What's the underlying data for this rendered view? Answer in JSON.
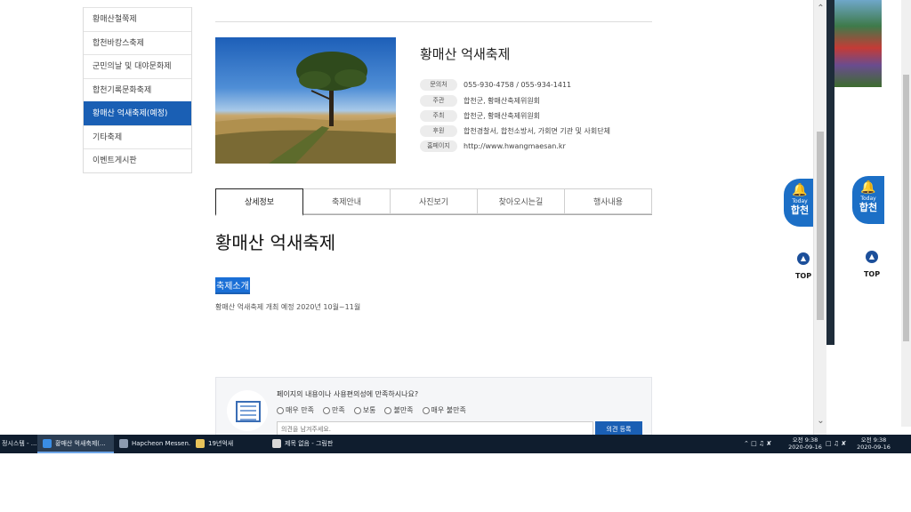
{
  "sidebar": {
    "items": [
      {
        "label": "황매산철쭉제"
      },
      {
        "label": "합천바캉스축제"
      },
      {
        "label": "군민의날 및 대야문화제"
      },
      {
        "label": "합천기록문화축제"
      },
      {
        "label": "황매산 억새축제(예정)"
      },
      {
        "label": "기타축제"
      },
      {
        "label": "이벤트게시판"
      }
    ]
  },
  "festival": {
    "title": "황매산 억새축제",
    "info": [
      {
        "label": "문의처",
        "value": "055-930-4758 / 055-934-1411"
      },
      {
        "label": "주관",
        "value": "합천군, 황매산축제위원회"
      },
      {
        "label": "주최",
        "value": "합천군, 황매산축제위원회"
      },
      {
        "label": "후원",
        "value": "합천경찰서, 합천소방서, 가회면 기관 및 사회단체"
      },
      {
        "label": "홈페이지",
        "value": "http://www.hwangmaesan.kr"
      }
    ]
  },
  "tabs": [
    {
      "label": "상세정보"
    },
    {
      "label": "축제안내"
    },
    {
      "label": "사진보기"
    },
    {
      "label": "찾아오시는길"
    },
    {
      "label": "행사내용"
    }
  ],
  "content": {
    "title": "황매산 억새축제",
    "intro_label": "축제소개",
    "intro_text": "황매산 억새축제 개최 예정 2020년 10월~11월"
  },
  "survey": {
    "question": "페이지의 내용이나 사용편의성에 만족하시나요?",
    "options": [
      "매우 만족",
      "만족",
      "보통",
      "불만족",
      "매우 불만족"
    ],
    "placeholder": "의견을 남겨주세요.",
    "submit_label": "의견 등록"
  },
  "floating": {
    "today_small": "Today",
    "today_big": "합천",
    "top_label": "TOP"
  },
  "taskbar": {
    "items": [
      {
        "label": "정시스템 - ..."
      },
      {
        "label": "황매산 억새축제(..."
      },
      {
        "label": "Hapcheon Messen..."
      },
      {
        "label": "19년억새"
      },
      {
        "label": "제목 없음 - 그림판"
      }
    ],
    "clock_time": "오전 9:38",
    "clock_date": "2020-09-16",
    "clock2_time": "오전 9:38",
    "clock2_date": "2020-09-16"
  },
  "colors": {
    "accent": "#1a5fb4",
    "taskbar": "#0f1d2e"
  }
}
